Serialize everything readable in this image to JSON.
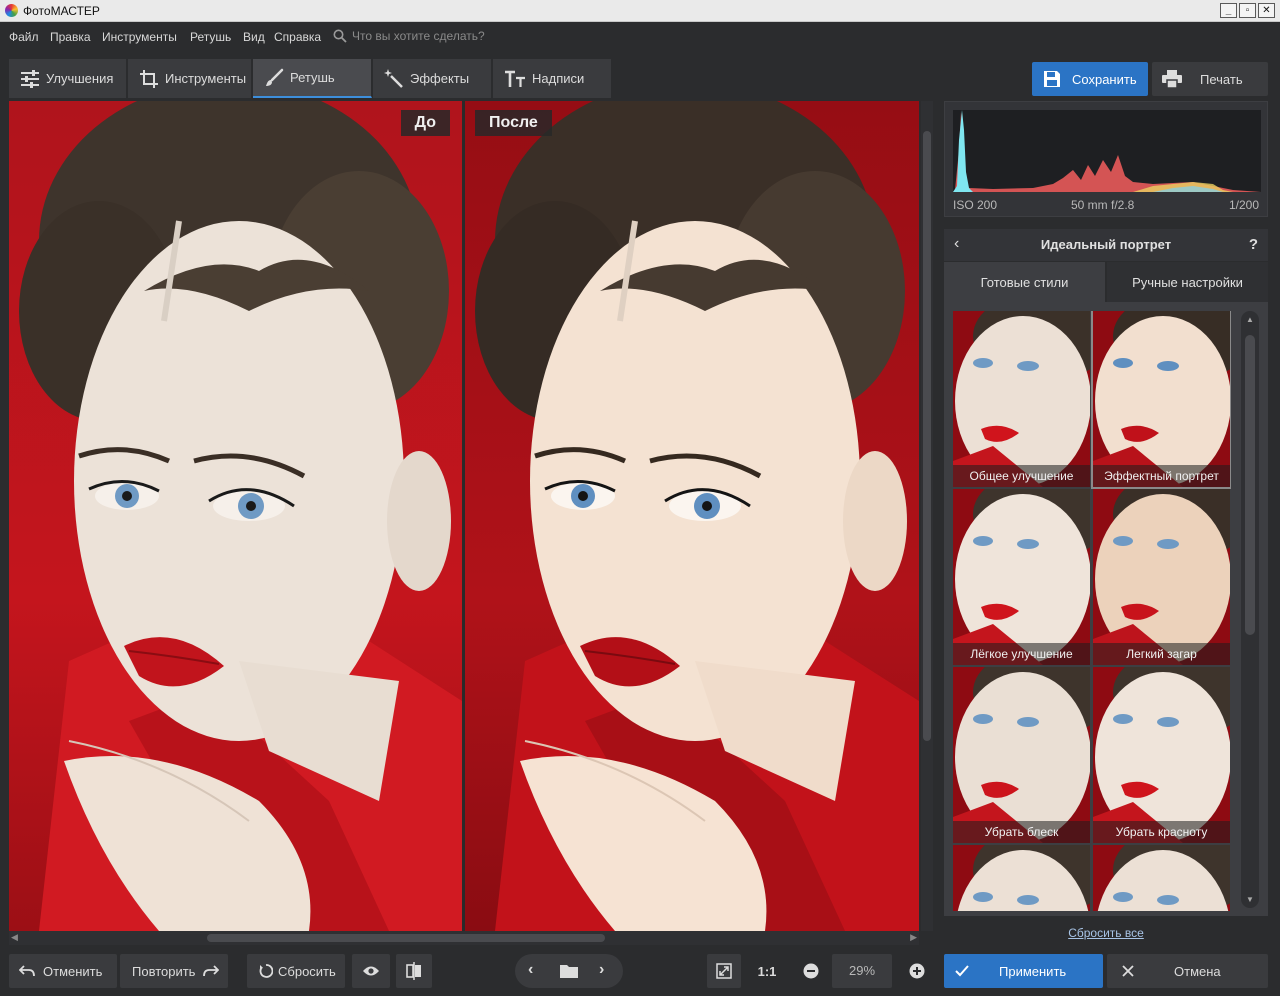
{
  "window": {
    "title": "ФотоМАСТЕР"
  },
  "menu": {
    "items": [
      "Файл",
      "Правка",
      "Инструменты",
      "Ретушь",
      "Вид",
      "Справка"
    ],
    "search_placeholder": "Что вы хотите сделать?"
  },
  "tabs": [
    {
      "label": "Улучшения",
      "icon": "sliders-icon"
    },
    {
      "label": "Инструменты",
      "icon": "crop-icon"
    },
    {
      "label": "Ретушь",
      "icon": "brush-icon",
      "active": true
    },
    {
      "label": "Эффекты",
      "icon": "magic-wand-icon"
    },
    {
      "label": "Надписи",
      "icon": "text-icon"
    }
  ],
  "actions": {
    "save": "Сохранить",
    "print": "Печать"
  },
  "compare": {
    "before": "До",
    "after": "После"
  },
  "histogram": {
    "iso": "ISO 200",
    "lens": "50 mm f/2.8",
    "shutter": "1/200"
  },
  "panel": {
    "title": "Идеальный портрет",
    "help": "?",
    "tab_presets": "Готовые стили",
    "tab_manual": "Ручные настройки",
    "styles": [
      "Общее улучшение",
      "Эффектный портрет",
      "Лёгкое улучшение",
      "Легкий загар",
      "Убрать блеск",
      "Убрать красноту",
      "",
      ""
    ],
    "selected_style": "Эффектный портрет",
    "reset_all": "Сбросить все"
  },
  "bottom": {
    "undo": "Отменить",
    "redo": "Повторить",
    "reset": "Сбросить",
    "ratio": "1:1",
    "zoom": "29%",
    "apply": "Применить",
    "cancel": "Отмена"
  },
  "colors": {
    "accent": "#2b74c5",
    "backdrop_red": "#c4151d"
  }
}
